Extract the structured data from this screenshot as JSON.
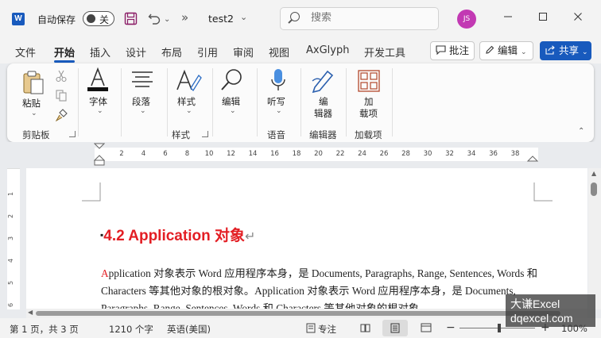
{
  "titlebar": {
    "app_logo": "W",
    "autosave_label": "自动保存",
    "autosave_state": "关",
    "more": "»",
    "doc_title": "test2",
    "search_placeholder": "搜索",
    "user_initials": "JS"
  },
  "menu": {
    "tabs": [
      "文件",
      "开始",
      "插入",
      "设计",
      "布局",
      "引用",
      "审阅",
      "视图",
      "AxGlyph",
      "开发工具"
    ],
    "active": "开始",
    "comment_btn": "批注",
    "edit_btn": "编辑",
    "share_btn": "共享"
  },
  "ribbon": {
    "clipboard": {
      "paste": "粘贴",
      "label": "剪贴板"
    },
    "font": {
      "btn": "字体"
    },
    "paragraph": {
      "btn": "段落"
    },
    "styles": {
      "btn": "样式",
      "label": "样式"
    },
    "editing": {
      "btn": "编辑"
    },
    "voice": {
      "btn": "听写",
      "label": "语音"
    },
    "editor": {
      "btn_line1": "编",
      "btn_line2": "辑器",
      "label": "编辑器"
    },
    "addins": {
      "btn_line1": "加",
      "btn_line2": "载项",
      "label": "加载项"
    }
  },
  "ruler": {
    "numbers": [
      "2",
      "4",
      "6",
      "8",
      "10",
      "12",
      "14",
      "16",
      "18",
      "20",
      "22",
      "24",
      "26",
      "28",
      "30",
      "32",
      "34",
      "36",
      "38"
    ],
    "vertical_numbers": [
      "1",
      "2",
      "3",
      "4",
      "5",
      "6"
    ]
  },
  "document": {
    "heading": "4.2 Application  对象",
    "heading_mark": "↵",
    "para_first_letter": "A",
    "para_rest": "pplication 对象表示 Word 应用程序本身，是 Documents, Paragraphs, Range, Sentences, Words 和 Characters 等其他对象的根对象。Application 对象表示 Word 应用程序本身，是 Documents, Paragraphs, Range, Sentences, Words 和 Characters 等其他对象的根对象。"
  },
  "status": {
    "page": "第 1 页，共 3 页",
    "words": "1210 个字",
    "language": "英语(美国)",
    "focus": "专注",
    "zoom": "100%"
  },
  "watermark": {
    "line1": "大谦Excel",
    "line2": "dqexcel.com"
  },
  "colors": {
    "accent": "#185abd",
    "heading": "#e31e24",
    "avatar": "#c239b3"
  }
}
